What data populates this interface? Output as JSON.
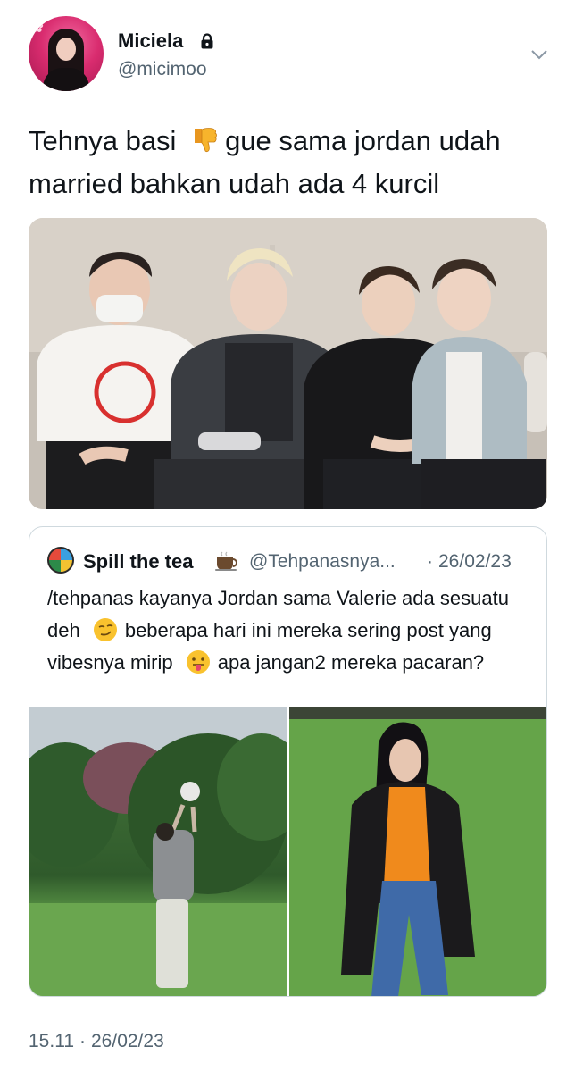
{
  "author": {
    "display_name": "Miciela",
    "handle": "@micimoo",
    "protected": true
  },
  "tweet": {
    "text_part1": "Tehnya basi",
    "emoji": "thumbs-down",
    "text_part2": "gue sama jordan udah married bahkan udah ada 4 kurcil"
  },
  "quoted_tweet": {
    "display_name": "Spill the tea",
    "name_emoji": "coffee-cup",
    "handle": "@Tehpanasnya...",
    "separator": "·",
    "date": "26/02/23",
    "text_part1": "/tehpanas kayanya Jordan sama Valerie ada sesuatu deh",
    "emoji1": "smirking-face",
    "text_part2": "beberapa hari ini mereka sering post yang vibesnya mirip",
    "emoji2": "tongue-face",
    "text_part3": "apa jangan2 mereka pacaran?"
  },
  "footer": {
    "time": "15.11",
    "separator": "·",
    "date": "26/02/23"
  },
  "colors": {
    "text": "#0f1419",
    "secondary": "#536471",
    "border": "#cfd9de"
  }
}
